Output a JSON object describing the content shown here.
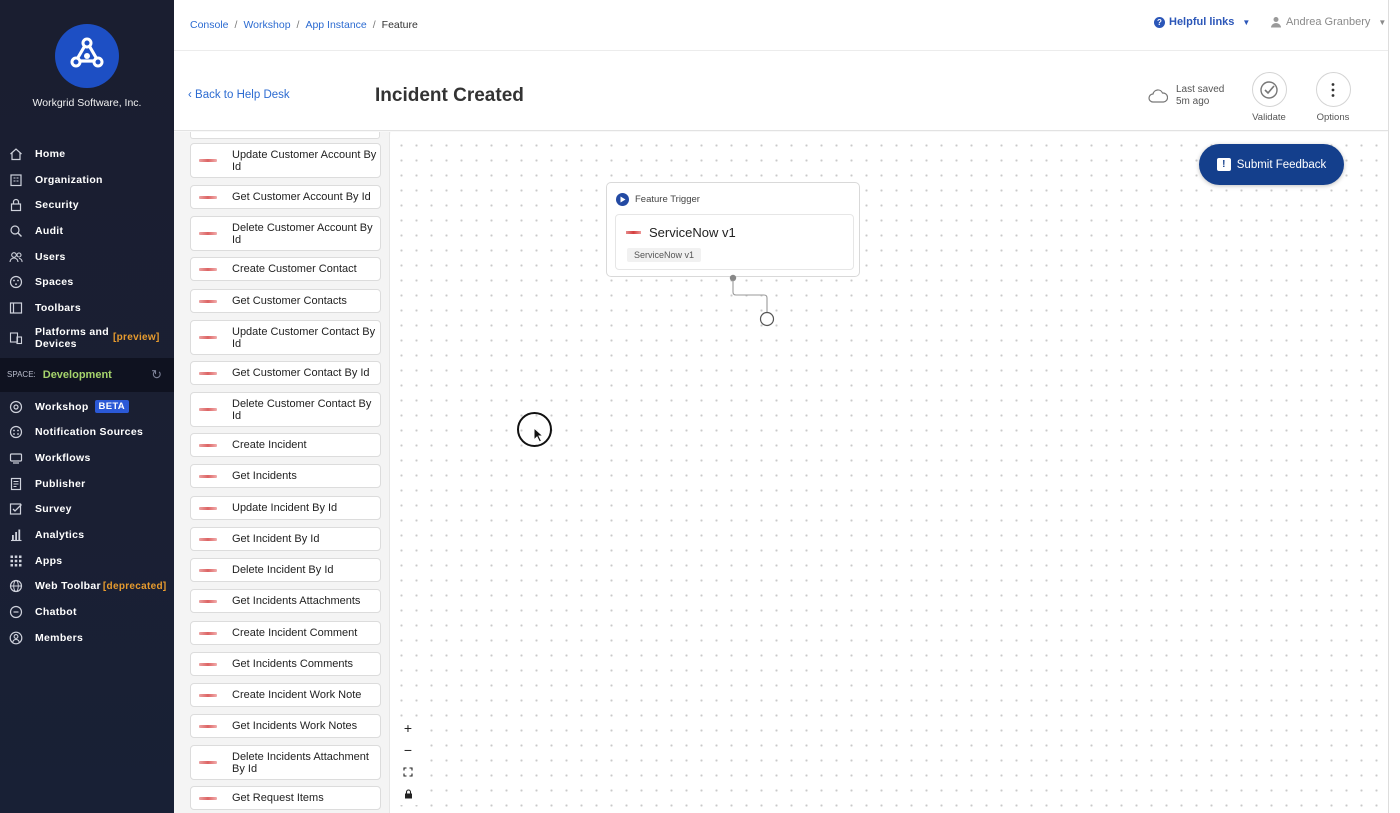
{
  "brand": {
    "company": "Workgrid Software, Inc."
  },
  "nav": {
    "items": [
      {
        "label": "Home",
        "icon": "home-icon"
      },
      {
        "label": "Organization",
        "icon": "building-icon"
      },
      {
        "label": "Security",
        "icon": "lock-icon"
      },
      {
        "label": "Audit",
        "icon": "audit-icon"
      },
      {
        "label": "Users",
        "icon": "users-icon"
      },
      {
        "label": "Spaces",
        "icon": "spaces-icon"
      },
      {
        "label": "Toolbars",
        "icon": "toolbar-icon"
      }
    ],
    "platforms": {
      "label": "Platforms and Devices",
      "tag": "[preview]"
    },
    "space": {
      "prefix": "SPACE:",
      "name": "Development"
    },
    "workshop": {
      "label": "Workshop",
      "badge": "BETA"
    },
    "items2": [
      {
        "label": "Notification Sources",
        "icon": "notification-sources-icon"
      },
      {
        "label": "Workflows",
        "icon": "workflows-icon"
      },
      {
        "label": "Publisher",
        "icon": "publisher-icon"
      },
      {
        "label": "Survey",
        "icon": "survey-icon"
      },
      {
        "label": "Analytics",
        "icon": "analytics-icon"
      },
      {
        "label": "Apps",
        "icon": "apps-icon"
      }
    ],
    "web_toolbar": {
      "label": "Web Toolbar",
      "tag": "[deprecated]"
    },
    "items3": [
      {
        "label": "Chatbot",
        "icon": "chatbot-icon"
      },
      {
        "label": "Members",
        "icon": "members-icon"
      }
    ]
  },
  "breadcrumb": [
    "Console",
    "Workshop",
    "App Instance",
    "Feature"
  ],
  "topbar": {
    "helpful_links": "Helpful links",
    "user_name": "Andrea Granbery"
  },
  "header": {
    "back_label": "Back to Help Desk",
    "title": "Incident Created",
    "last_saved_label": "Last saved",
    "last_saved_time": "5m ago",
    "validate_label": "Validate",
    "options_label": "Options"
  },
  "components": [
    "Update Customer Account By Id",
    "Get Customer Account By Id",
    "Delete Customer Account By Id",
    "Create Customer Contact",
    "Get Customer Contacts",
    "Update Customer Contact By Id",
    "Get Customer Contact By Id",
    "Delete Customer Contact By Id",
    "Create Incident",
    "Get Incidents",
    "Update Incident By Id",
    "Get Incident By Id",
    "Delete Incident By Id",
    "Get Incidents Attachments",
    "Create Incident Comment",
    "Get Incidents Comments",
    "Create Incident Work Note",
    "Get Incidents Work Notes",
    "Delete Incidents Attachment By Id",
    "Get Request Items"
  ],
  "canvas": {
    "feedback_label": "Submit Feedback",
    "node": {
      "header": "Feature Trigger",
      "title": "ServiceNow v1",
      "pill": "ServiceNow v1"
    }
  },
  "colors": {
    "nav_bg": "#1b1f31",
    "accent_blue": "#2c6bd1",
    "feedback_bg": "#143f8c",
    "space_green": "#a6d46c",
    "tag_orange": "#e79b2e"
  }
}
